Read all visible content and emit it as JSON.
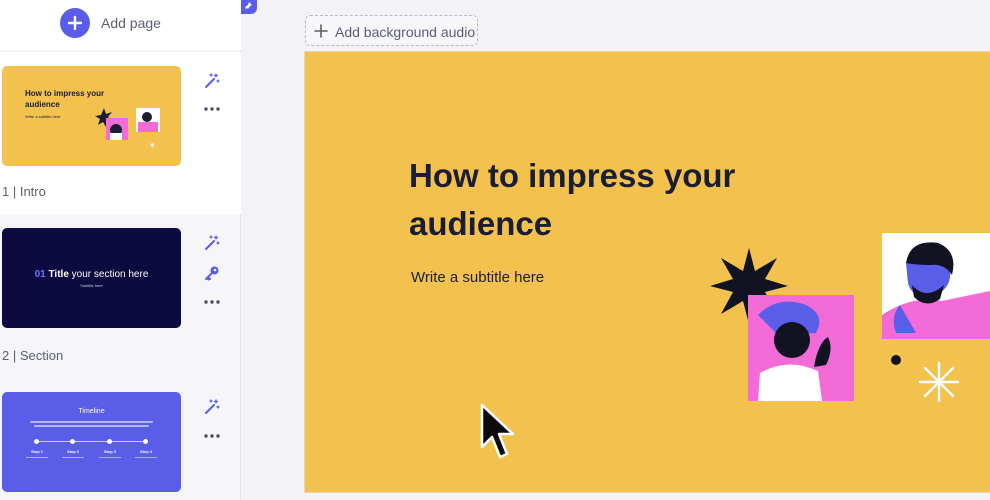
{
  "sidebar": {
    "add_page_label": "Add page",
    "pages": [
      {
        "label": "1 | Intro",
        "thumb_title": "How to impress your audience",
        "thumb_subtitle": "Write a subtitle here"
      },
      {
        "label": "2 | Section",
        "thumb_number": "01",
        "thumb_title_bold": "Title",
        "thumb_title_rest": " your section here",
        "thumb_subtitle": "Subtitle here"
      },
      {
        "label": "",
        "thumb_title": "Timeline",
        "steps": [
          "Step 1",
          "Step 2",
          "Step 3",
          "Step 4"
        ]
      }
    ]
  },
  "toolbar": {
    "audio_label": "Add background audio"
  },
  "slide": {
    "title": "How to impress your audience",
    "subtitle": "Write a subtitle here"
  },
  "colors": {
    "accent": "#5a5de8",
    "slide_yellow": "#f2c14e",
    "section_navy": "#0c0a3e",
    "pink": "#f26bd6",
    "figure_blue": "#5a5de8"
  },
  "icons": {
    "add": "plus-icon",
    "magic": "magic-wand-icon",
    "more": "more-dots-icon",
    "key": "key-icon",
    "pin": "pin-icon",
    "cursor": "mouse-cursor-icon"
  }
}
